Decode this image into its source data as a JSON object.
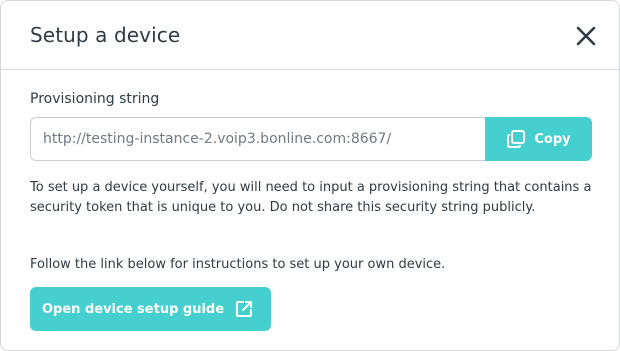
{
  "dialog": {
    "title": "Setup a device",
    "close_icon": "close-icon"
  },
  "provisioning": {
    "label": "Provisioning string",
    "value": "http://testing-instance-2.voip3.bonline.com:8667/",
    "copy_label": "Copy",
    "copy_icon": "copy-icon"
  },
  "description": "To set up a device yourself, you will need to input a provisioning string that contains a security token that is unique to you. Do not share this security string publicly.",
  "follow_text": "Follow the link below for instructions to set up your own device.",
  "guide_button": {
    "label": "Open device setup guide",
    "icon": "external-link-icon"
  },
  "colors": {
    "accent": "#45cfcf",
    "text": "#2f3b45",
    "border": "#d5d9dc"
  }
}
